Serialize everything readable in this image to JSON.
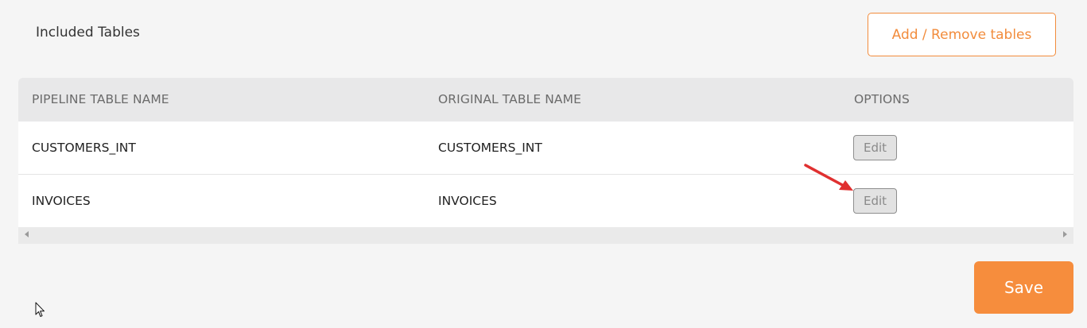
{
  "section": {
    "title": "Included Tables"
  },
  "toolbar": {
    "add_remove_label": "Add / Remove tables"
  },
  "table": {
    "headers": [
      "PIPELINE TABLE NAME",
      "ORIGINAL TABLE NAME",
      "OPTIONS"
    ],
    "rows": [
      {
        "pipeline_name": "CUSTOMERS_INT",
        "original_name": "CUSTOMERS_INT",
        "option_label": "Edit"
      },
      {
        "pipeline_name": "INVOICES",
        "original_name": "INVOICES",
        "option_label": "Edit"
      }
    ]
  },
  "footer": {
    "save_label": "Save"
  },
  "colors": {
    "accent": "#f68d3d",
    "annotation": "#e03030"
  },
  "icons": {
    "scroll_left": "scroll-left-arrow-icon",
    "scroll_right": "scroll-right-arrow-icon",
    "cursor": "mouse-pointer-icon",
    "annotation": "red-arrow-icon"
  }
}
